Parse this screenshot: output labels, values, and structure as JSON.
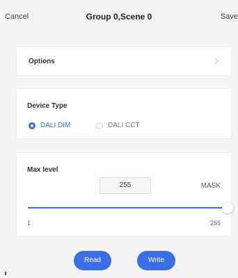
{
  "header": {
    "cancel_label": "Cancel",
    "title": "Group 0,Scene 0",
    "save_label": "Save"
  },
  "options": {
    "label": "Options",
    "icon": "chevron-right-icon"
  },
  "device_type": {
    "label": "Device Type",
    "options": [
      {
        "label": "DALI DIM",
        "selected": true
      },
      {
        "label": "DALI CCT",
        "selected": false
      }
    ]
  },
  "max_level": {
    "label": "Max level",
    "value": "255",
    "mask_label": "MASK",
    "slider": {
      "min": 1,
      "max": 255,
      "value": 255
    },
    "min_label": "1",
    "max_label": "255"
  },
  "actions": {
    "read_label": "Read",
    "write_label": "Write"
  },
  "colors": {
    "accent": "#3a6ee8",
    "background": "#f4f4f4",
    "card": "#ffffff"
  }
}
